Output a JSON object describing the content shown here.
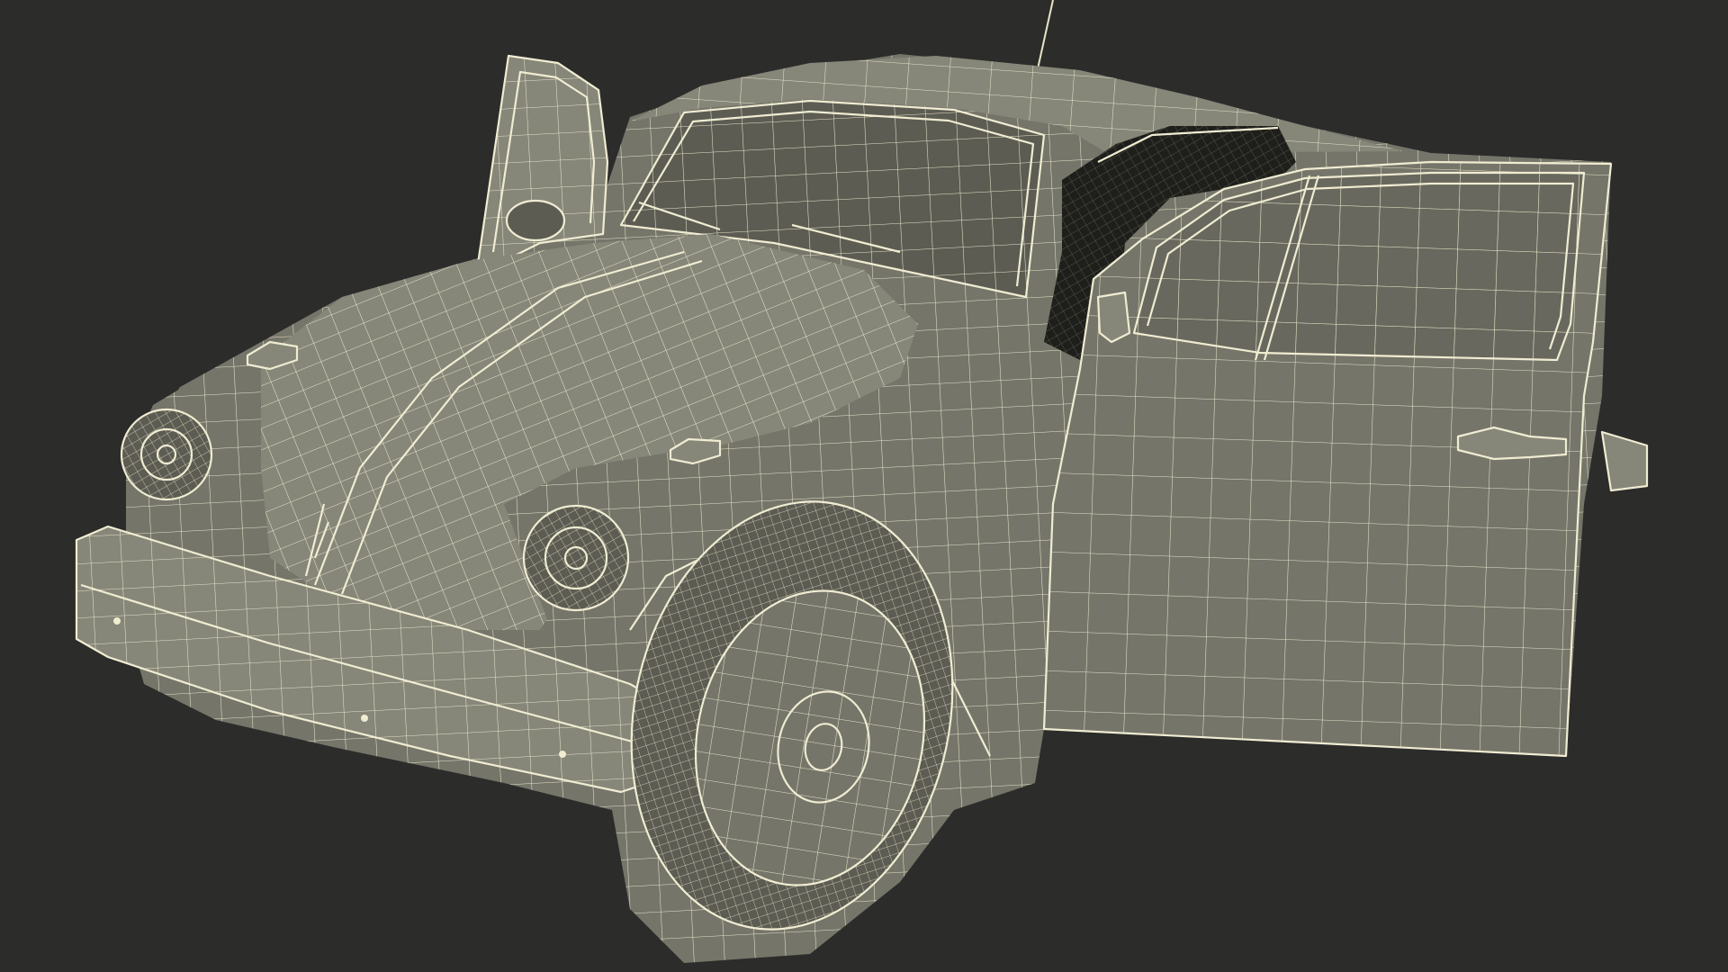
{
  "scene": {
    "subject": "car-wireframe-render",
    "colors": {
      "background": "#2c2c2b",
      "surface": "#75756a",
      "wireframe": "#e8e4c8"
    }
  }
}
